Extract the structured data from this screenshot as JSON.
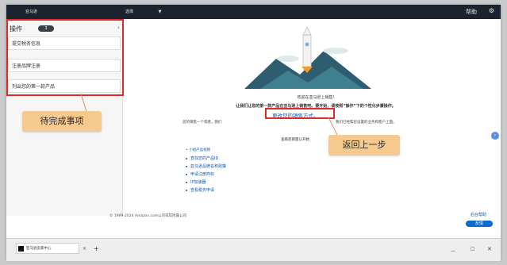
{
  "topbar": {
    "brand": "亚马逊",
    "marketplace": "选择",
    "help": "帮助",
    "settings_icon": "gear-icon"
  },
  "sidebar": {
    "title": "操作",
    "count": "3",
    "items": [
      {
        "label": "提交税务信息"
      },
      {
        "label": "注册品牌注册"
      },
      {
        "label": "列出您的第一款产品"
      }
    ]
  },
  "callouts": {
    "pending": "待完成事项",
    "go_back": "返回上一步"
  },
  "main": {
    "welcome": "欢迎在亚马逊上销售!",
    "instruction": "让我们让您的第一款产品在亚马逊上销售吧。要开始，请按照“操作”下的个性化步骤操作。",
    "change_link": "更改您的销售方式。",
    "left_text": "您的销售一个或者，我们",
    "right_text": "我们已经帮您设置的业务和客户上面。",
    "learn_button": "查看拒销量认开始",
    "resources_title": "• 小组产品视频",
    "resources": [
      {
        "label": "查找您的产品ID"
      },
      {
        "label": "亚马逊品牌名称政策"
      },
      {
        "label": "申请注册商标"
      },
      {
        "label": "IP加速器"
      },
      {
        "label": "查看税务申请"
      }
    ]
  },
  "footer": {
    "copyright": "© 1999-2024 Amazon.com公司或其附属公司",
    "help_link": "后台帮助",
    "feedback": "反馈"
  },
  "taskbar": {
    "tab_label": "亚马逊卖家中心",
    "tab_close": "×",
    "tab_add": "+",
    "min": "—",
    "max": "☐",
    "close": "✕"
  },
  "colors": {
    "accent_red": "#e02a2a",
    "callout_bg": "#f6c98f",
    "link_blue": "#0b5cad",
    "topbar_bg": "#1b232f"
  }
}
